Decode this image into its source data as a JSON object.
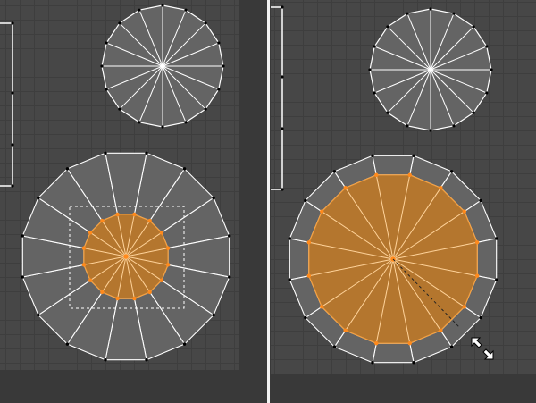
{
  "colors": {
    "background": "#393939",
    "viewport": "#474747",
    "grid": "#3e3e3e",
    "face": "#646464",
    "edge": "#ffffff",
    "vertex": "#000000",
    "selected_face": "#b4762e",
    "selected_edge": "#f5a040",
    "selected_vertex": "#ff8a1c",
    "divider": "#f2f2f2"
  },
  "panels": {
    "before": {
      "label": "",
      "mode": "edit-mesh",
      "selection": "inner-ring-and-center",
      "tool": "box-select"
    },
    "after": {
      "label": "",
      "mode": "edit-mesh",
      "selection": "scaled-inner-ring",
      "tool": "scale"
    }
  },
  "icons": [
    "scale-cursor-icon"
  ]
}
